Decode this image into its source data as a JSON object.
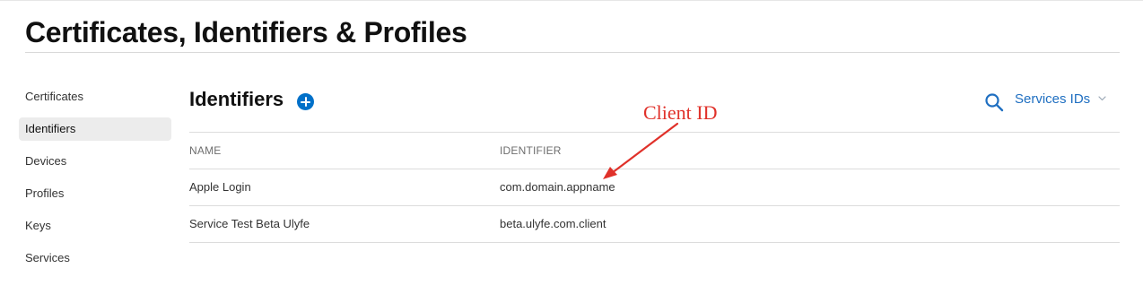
{
  "page": {
    "title": "Certificates, Identifiers & Profiles"
  },
  "sidebar": {
    "items": [
      {
        "label": "Certificates",
        "active": false
      },
      {
        "label": "Identifiers",
        "active": true
      },
      {
        "label": "Devices",
        "active": false
      },
      {
        "label": "Profiles",
        "active": false
      },
      {
        "label": "Keys",
        "active": false
      },
      {
        "label": "Services",
        "active": false
      }
    ]
  },
  "main": {
    "section_title": "Identifiers",
    "filter_label": "Services IDs",
    "icons": {
      "add": "plus-circle-icon",
      "search": "search-icon",
      "filter": "chevron-down-icon"
    },
    "table": {
      "columns": [
        "NAME",
        "IDENTIFIER"
      ],
      "rows": [
        {
          "name": "Apple Login",
          "identifier": "com.domain.appname"
        },
        {
          "name": "Service Test Beta Ulyfe",
          "identifier": "beta.ulyfe.com.client"
        }
      ]
    }
  },
  "annotation": {
    "label": "Client ID",
    "color": "#e0312a"
  },
  "colors": {
    "accent": "#0070c9",
    "link": "#1f6fc1",
    "sidebar_active_bg": "#ececec"
  }
}
